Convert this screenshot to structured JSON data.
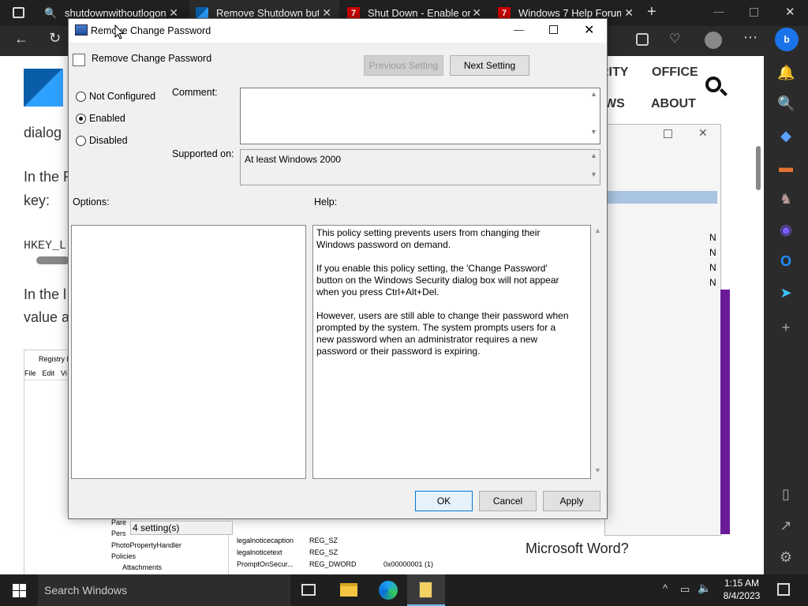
{
  "browser": {
    "tabs": [
      {
        "label": "shutdownwithoutlogon",
        "icon": "search-icon"
      },
      {
        "label": "Remove Shutdown butt",
        "icon": "windows-logo-icon"
      },
      {
        "label": "Shut Down - Enable or",
        "icon": "tenforums-icon"
      },
      {
        "label": "Windows 7 Help Forum",
        "icon": "sevenforums-icon"
      }
    ],
    "page": {
      "nav": [
        "RITY",
        "OFFICE",
        "WS",
        "ABOUT"
      ],
      "texts": [
        "dialog",
        "In the R",
        "key:",
        "HKEY_L",
        "In the l",
        "value a"
      ],
      "bottom_heading": "Microsoft Word?",
      "registry": {
        "title": "Registry E",
        "menu": [
          "File",
          "Edit",
          "Vi"
        ],
        "tree": [
          "Pare",
          "Pers",
          "PhotoPropertyHandler",
          "Policies",
          "Attachments"
        ],
        "rows": [
          [
            "legalnoticecaption",
            "REG_SZ",
            ""
          ],
          [
            "legalnoticetext",
            "REG_SZ",
            ""
          ],
          [
            "PromptOnSecur...",
            "REG_DWORD",
            "0x00000001 (1)"
          ]
        ]
      },
      "list_letters": [
        "N",
        "N",
        "N",
        "N"
      ]
    }
  },
  "dialog": {
    "title": "Remove Change Password",
    "policy_name": "Remove Change Password",
    "prev_label": "Previous Setting",
    "next_label": "Next Setting",
    "options": [
      "Not Configured",
      "Enabled",
      "Disabled"
    ],
    "selected": "Enabled",
    "comment_label": "Comment:",
    "supported_label": "Supported on:",
    "supported_value": "At least Windows 2000",
    "options_label": "Options:",
    "help_label": "Help:",
    "help_paragraphs": [
      "This policy setting prevents users from changing their Windows password on demand.",
      "If you enable this policy setting,  the 'Change Password' button on the Windows Security dialog box will not appear when you press Ctrl+Alt+Del.",
      "However, users are still able to change their password when prompted by the system. The system prompts users for a new password when an administrator requires a new password or their password is expiring."
    ],
    "ok_label": "OK",
    "cancel_label": "Cancel",
    "apply_label": "Apply",
    "status": "4 setting(s)"
  },
  "taskbar": {
    "search_placeholder": "Search Windows",
    "time": "1:15 AM",
    "date": "8/4/2023"
  },
  "colors": {
    "accent": "#0078d7",
    "dark_bar": "#202020",
    "dialog_bg": "#f0f0f0"
  }
}
